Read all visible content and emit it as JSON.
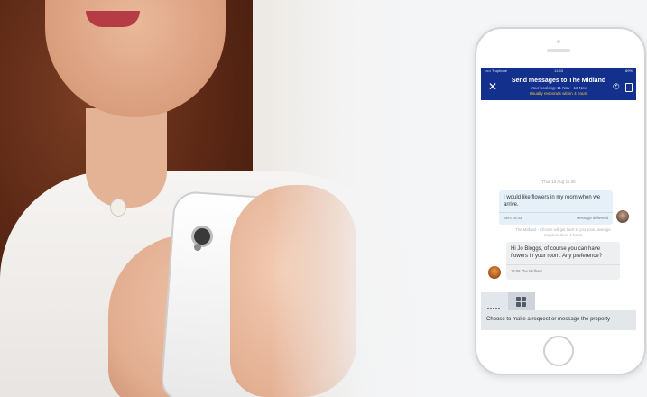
{
  "status_bar": {
    "carrier": "••••• Truphone",
    "time": "11:53",
    "battery": "89%"
  },
  "header": {
    "title": "Send messages to The Midland",
    "booking": "Your booking: 11 Nov - 13 Nov",
    "response_time": "Usually responds within 4 hours"
  },
  "conversation": {
    "date_label": "Thur 13 Aug 11:35",
    "outgoing": {
      "text": "I would like flowers in my room when we arrive.",
      "sent": "Sent 19:43",
      "status": "Message delivered"
    },
    "system_note": "The Midland - Choose will get back to you soon, average response time: 4 hours",
    "incoming": {
      "text": "Hi Jo Bloggs, of course you can have flowers in your room. Any preference?",
      "meta": "16:06  The Midland"
    }
  },
  "composer": {
    "placeholder": "Choose to make a request or message the property"
  },
  "colors": {
    "header_bg": "#13308c",
    "accent_yellow": "#f4c542"
  }
}
